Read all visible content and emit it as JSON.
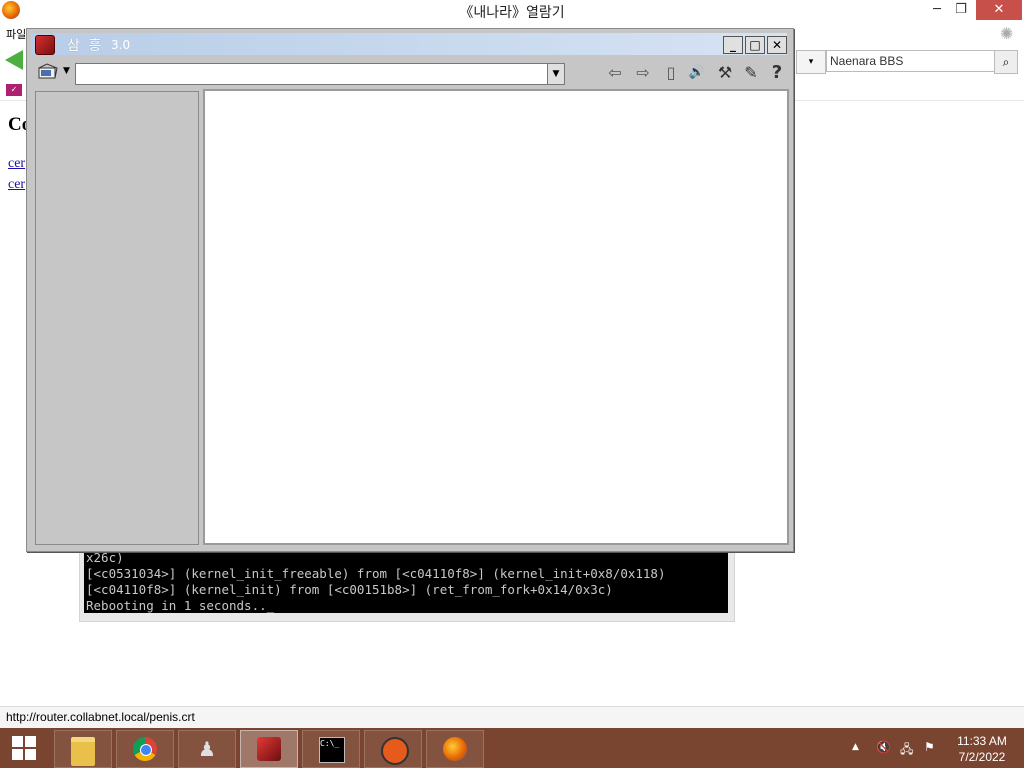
{
  "browser": {
    "title": "《내나라》열람기",
    "menu_fragment": "파일",
    "minimize_label": "─",
    "restore_label": "❐",
    "close_label": "✕",
    "search": {
      "engine_label": "▾",
      "value": "Naenara BBS"
    },
    "page_heading": "Co",
    "links": [
      "cer",
      "cer"
    ],
    "status_text": "http://router.collabnet.local/penis.crt"
  },
  "console": {
    "lines": [
      "x26c)",
      "[<c0531034>] (kernel_init_freeable) from [<c04110f8>] (kernel_init+0x8/0x118)",
      "[<c04110f8>] (kernel_init) from [<c00151b8>] (ret_from_fork+0x14/0x3c)",
      "Rebooting in 1 seconds.._"
    ]
  },
  "window": {
    "title": "삼 흥",
    "version": "3.0",
    "minimize_label": "_",
    "maximize_label": "□",
    "close_label": "✕",
    "combo_value": "",
    "tools": [
      {
        "name": "back-arrow-icon",
        "glyph": "⇦"
      },
      {
        "name": "forward-arrow-icon",
        "glyph": "⇨"
      },
      {
        "name": "page-icon",
        "glyph": "▯"
      },
      {
        "name": "speaker-icon",
        "glyph": "🔊"
      },
      {
        "name": "tools-icon",
        "glyph": "⚒"
      },
      {
        "name": "notepad-icon",
        "glyph": "✎"
      },
      {
        "name": "help-icon",
        "glyph": "?"
      }
    ]
  },
  "taskbar": {
    "apps": [
      {
        "name": "file-explorer-icon",
        "active": false
      },
      {
        "name": "chrome-icon",
        "active": false
      },
      {
        "name": "chess-app-icon",
        "active": false
      },
      {
        "name": "samheung-icon",
        "active": true
      },
      {
        "name": "command-prompt-icon",
        "active": false
      },
      {
        "name": "qemu-icon",
        "active": false
      },
      {
        "name": "firefox-icon",
        "active": false
      }
    ],
    "clock_time": "11:33 AM",
    "clock_date": "7/2/2022"
  }
}
